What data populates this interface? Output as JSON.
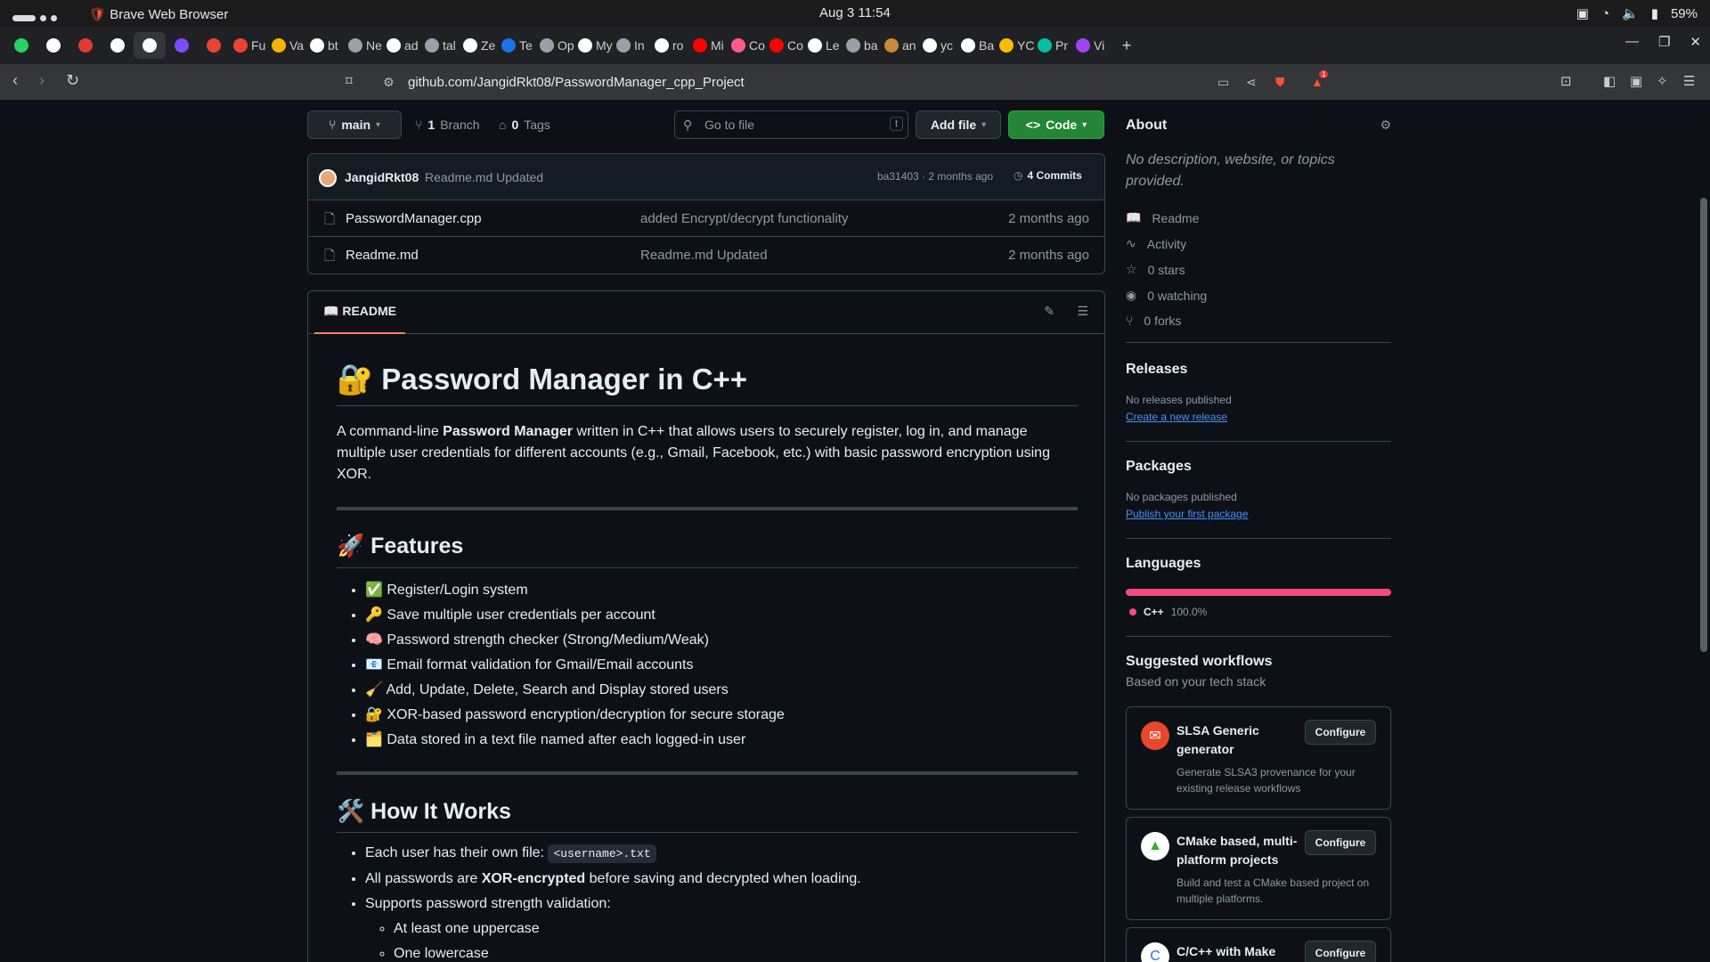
{
  "system": {
    "window_title": "Brave Web Browser",
    "clock": "Aug 3  11:54",
    "battery": "59%"
  },
  "tabs": [
    {
      "icon": "whatsapp-icon",
      "label": "",
      "color": "#25d366"
    },
    {
      "icon": "github-icon",
      "label": "",
      "color": "#ffffff"
    },
    {
      "icon": "app-icon",
      "label": "",
      "color": "#e53935"
    },
    {
      "icon": "github-icon",
      "label": "",
      "color": "#ffffff"
    },
    {
      "icon": "github-icon",
      "label": "",
      "color": "#ffffff"
    },
    {
      "icon": "app-icon",
      "label": "",
      "color": "#7c4dff"
    },
    {
      "icon": "gmail-icon",
      "label": "",
      "color": "#ea4335"
    },
    {
      "icon": "gmail-icon",
      "label": "Fu",
      "color": "#ea4335"
    },
    {
      "icon": "app-icon",
      "label": "Va",
      "color": "#f4b400"
    },
    {
      "icon": "github-icon",
      "label": "bt",
      "color": "#ffffff"
    },
    {
      "icon": "app-icon",
      "label": "Ne",
      "color": "#9aa0a6"
    },
    {
      "icon": "github-icon",
      "label": "ad",
      "color": "#ffffff"
    },
    {
      "icon": "app-icon",
      "label": "tal",
      "color": "#9aa0a6"
    },
    {
      "icon": "github-icon",
      "label": "Ze",
      "color": "#ffffff"
    },
    {
      "icon": "app-icon",
      "label": "Te",
      "color": "#1a73e8"
    },
    {
      "icon": "app-icon",
      "label": "Op",
      "color": "#9aa0a6"
    },
    {
      "icon": "app-icon",
      "label": "My",
      "color": "#ffffff"
    },
    {
      "icon": "app-icon",
      "label": "In",
      "color": "#9aa0a6"
    },
    {
      "icon": "github-icon",
      "label": "ro",
      "color": "#ffffff"
    },
    {
      "icon": "youtube-icon",
      "label": "Mi",
      "color": "#ff0000"
    },
    {
      "icon": "app-icon",
      "label": "Co",
      "color": "#ff5c8a"
    },
    {
      "icon": "youtube-icon",
      "label": "Co",
      "color": "#ff0000"
    },
    {
      "icon": "github-icon",
      "label": "Le",
      "color": "#ffffff"
    },
    {
      "icon": "app-icon",
      "label": "ba",
      "color": "#9aa0a6"
    },
    {
      "icon": "app-icon",
      "label": "an",
      "color": "#c58a3a"
    },
    {
      "icon": "app-icon",
      "label": "yc",
      "color": "#ffffff"
    },
    {
      "icon": "app-icon",
      "label": "Ba",
      "color": "#ffffff"
    },
    {
      "icon": "app-icon",
      "label": "YC",
      "color": "#fbbc04"
    },
    {
      "icon": "app-icon",
      "label": "Pr",
      "color": "#00bfa5"
    },
    {
      "icon": "app-icon",
      "label": "Vi",
      "color": "#a142f4"
    }
  ],
  "address": {
    "url": "github.com/JangidRkt08/PasswordManager_cpp_Project",
    "notif_count": "1"
  },
  "repo_bar": {
    "branch": "main",
    "branch_count": "1",
    "branch_label": "Branch",
    "tag_count": "0",
    "tag_label": "Tags",
    "goto_placeholder": "Go to file",
    "goto_key": "t",
    "add_file": "Add file",
    "code": "Code"
  },
  "commit": {
    "author": "JangidRkt08",
    "message": "Readme.md Updated",
    "meta": "ba31403 · 2 months ago",
    "commits": "4 Commits"
  },
  "files": [
    {
      "name": "PasswordManager.cpp",
      "message": "added Encrypt/decrypt functionality",
      "date": "2 months ago"
    },
    {
      "name": "Readme.md",
      "message": "Readme.md Updated",
      "date": "2 months ago"
    }
  ],
  "readme": {
    "tab": "README",
    "title": "🔐 Password Manager in C++",
    "intro_pre": "A command-line ",
    "intro_bold": "Password Manager",
    "intro_post": " written in C++ that allows users to securely register, log in, and manage multiple user credentials for different accounts (e.g., Gmail, Facebook, etc.) with basic password encryption using XOR.",
    "features_title": "🚀 Features",
    "features": [
      "✅ Register/Login system",
      "🔑 Save multiple user credentials per account",
      "🧠 Password strength checker (Strong/Medium/Weak)",
      "📧 Email format validation for Gmail/Email accounts",
      "🧹 Add, Update, Delete, Search and Display stored users",
      "🔐 XOR-based password encryption/decryption for secure storage",
      "🗂️ Data stored in a text file named after each logged-in user"
    ],
    "how_title": "🛠️ How It Works",
    "how1_pre": "Each user has their own file: ",
    "how1_code": "<username>.txt",
    "how2_pre": "All passwords are ",
    "how2_bold": "XOR-encrypted",
    "how2_post": " before saving and decrypted when loading.",
    "how3": "Supports password strength validation:",
    "sub": [
      "At least one uppercase",
      "One lowercase"
    ]
  },
  "about": {
    "title": "About",
    "description": "No description, website, or topics provided.",
    "readme": "Readme",
    "activity": "Activity",
    "stars": "0 stars",
    "watching": "0 watching",
    "forks": "0 forks"
  },
  "releases": {
    "title": "Releases",
    "empty": "No releases published",
    "link": "Create a new release"
  },
  "packages": {
    "title": "Packages",
    "empty": "No packages published",
    "link": "Publish your first package"
  },
  "languages": {
    "title": "Languages",
    "name": "C++",
    "percent": "100.0%",
    "color": "#f34b7d"
  },
  "workflows": {
    "title": "Suggested workflows",
    "subtitle": "Based on your tech stack",
    "items": [
      {
        "title": "SLSA Generic generator",
        "desc": "Generate SLSA3 provenance for your existing release workflows",
        "button": "Configure"
      },
      {
        "title": "CMake based, multi-platform projects",
        "desc": "Build and test a CMake based project on multiple platforms.",
        "button": "Configure"
      },
      {
        "title": "C/C++ with Make",
        "desc": "",
        "button": "Configure"
      }
    ]
  }
}
